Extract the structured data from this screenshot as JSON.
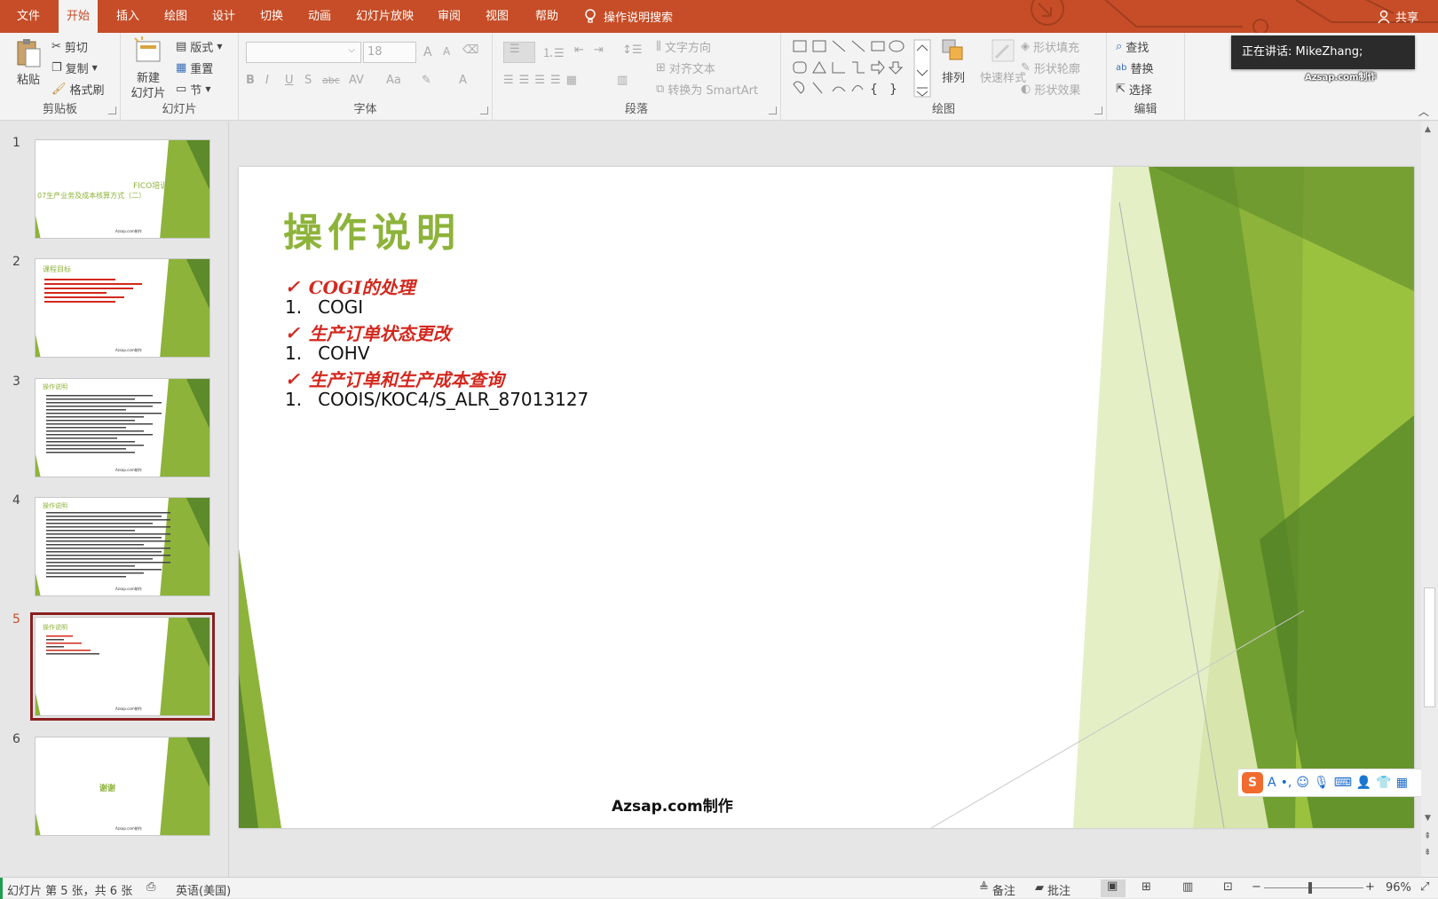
{
  "tabs": [
    {
      "label": "文件"
    },
    {
      "label": "开始"
    },
    {
      "label": "插入"
    },
    {
      "label": "绘图"
    },
    {
      "label": "设计"
    },
    {
      "label": "切换"
    },
    {
      "label": "动画"
    },
    {
      "label": "幻灯片放映"
    },
    {
      "label": "审阅"
    },
    {
      "label": "视图"
    },
    {
      "label": "帮助"
    }
  ],
  "tell_me": "操作说明搜索",
  "share_label": "共享",
  "ribbon": {
    "clipboard": {
      "label": "剪贴板",
      "paste": "粘贴",
      "cut": "剪切",
      "copy": "复制",
      "format_painter": "格式刷"
    },
    "slides": {
      "label": "幻灯片",
      "new_slide_line1": "新建",
      "new_slide_line2": "幻灯片",
      "layout": "版式",
      "reset": "重置",
      "section": "节"
    },
    "font": {
      "label": "字体",
      "size": "18",
      "bold": "B",
      "italic": "I",
      "underline": "U",
      "shadow": "S",
      "strike": "abc",
      "spacing": "AV",
      "case": "Aa",
      "color": "A",
      "grow": "A",
      "shrink": "A"
    },
    "paragraph": {
      "label": "段落",
      "text_direction": "文字方向",
      "align_text": "对齐文本",
      "convert_smartart": "转换为 SmartArt"
    },
    "drawing": {
      "label": "绘图",
      "arrange": "排列",
      "quick_styles": "快速样式",
      "shape_fill": "形状填充",
      "shape_outline": "形状轮廓",
      "shape_effects": "形状效果"
    },
    "editing": {
      "label": "编辑",
      "find": "查找",
      "replace": "替换",
      "select": "选择"
    }
  },
  "presenter_text": "正在讲话: MikeZhang;",
  "watermark_small": "Azsap.com制作",
  "thumbnails": [
    {
      "num": "1",
      "title": "FICO培训",
      "subtitle": "07生产业务及成本核算方式（二）",
      "footer": "Azsap.com制作"
    },
    {
      "num": "2",
      "title": "课程目标",
      "footer": "Azsap.com制作"
    },
    {
      "num": "3",
      "title": "操作说明",
      "footer": "Azsap.com制作"
    },
    {
      "num": "4",
      "title": "操作说明",
      "footer": "Azsap.com制作"
    },
    {
      "num": "5",
      "title": "操作说明",
      "footer": "Azsap.com制作"
    },
    {
      "num": "6",
      "title": "谢谢",
      "footer": "Azsap.com制作"
    }
  ],
  "slide": {
    "title": "操作说明",
    "bullets": [
      {
        "marker": "✓",
        "text": "COGI的处理",
        "style": "red"
      },
      {
        "marker": "1.",
        "text": "COGI",
        "style": "black"
      },
      {
        "marker": "✓",
        "text": "生产订单状态更改",
        "style": "red"
      },
      {
        "marker": "1.",
        "text": "COHV",
        "style": "black"
      },
      {
        "marker": "✓",
        "text": "生产订单和生产成本查询",
        "style": "red"
      },
      {
        "marker": "1.",
        "text": "COOIS/KOC4/S_ALR_87013127",
        "style": "black"
      }
    ],
    "footer": "Azsap.com制作"
  },
  "status": {
    "slide_info": "幻灯片 第 5 张，共 6 张",
    "language": "英语(美国)",
    "notes": "备注",
    "comments": "批注",
    "zoom": "96%"
  },
  "colors": {
    "accent": "#c64d27",
    "title_green": "#8db33a",
    "bullet_red": "#d3281e",
    "selected_thumb": "#8b1f1f"
  }
}
